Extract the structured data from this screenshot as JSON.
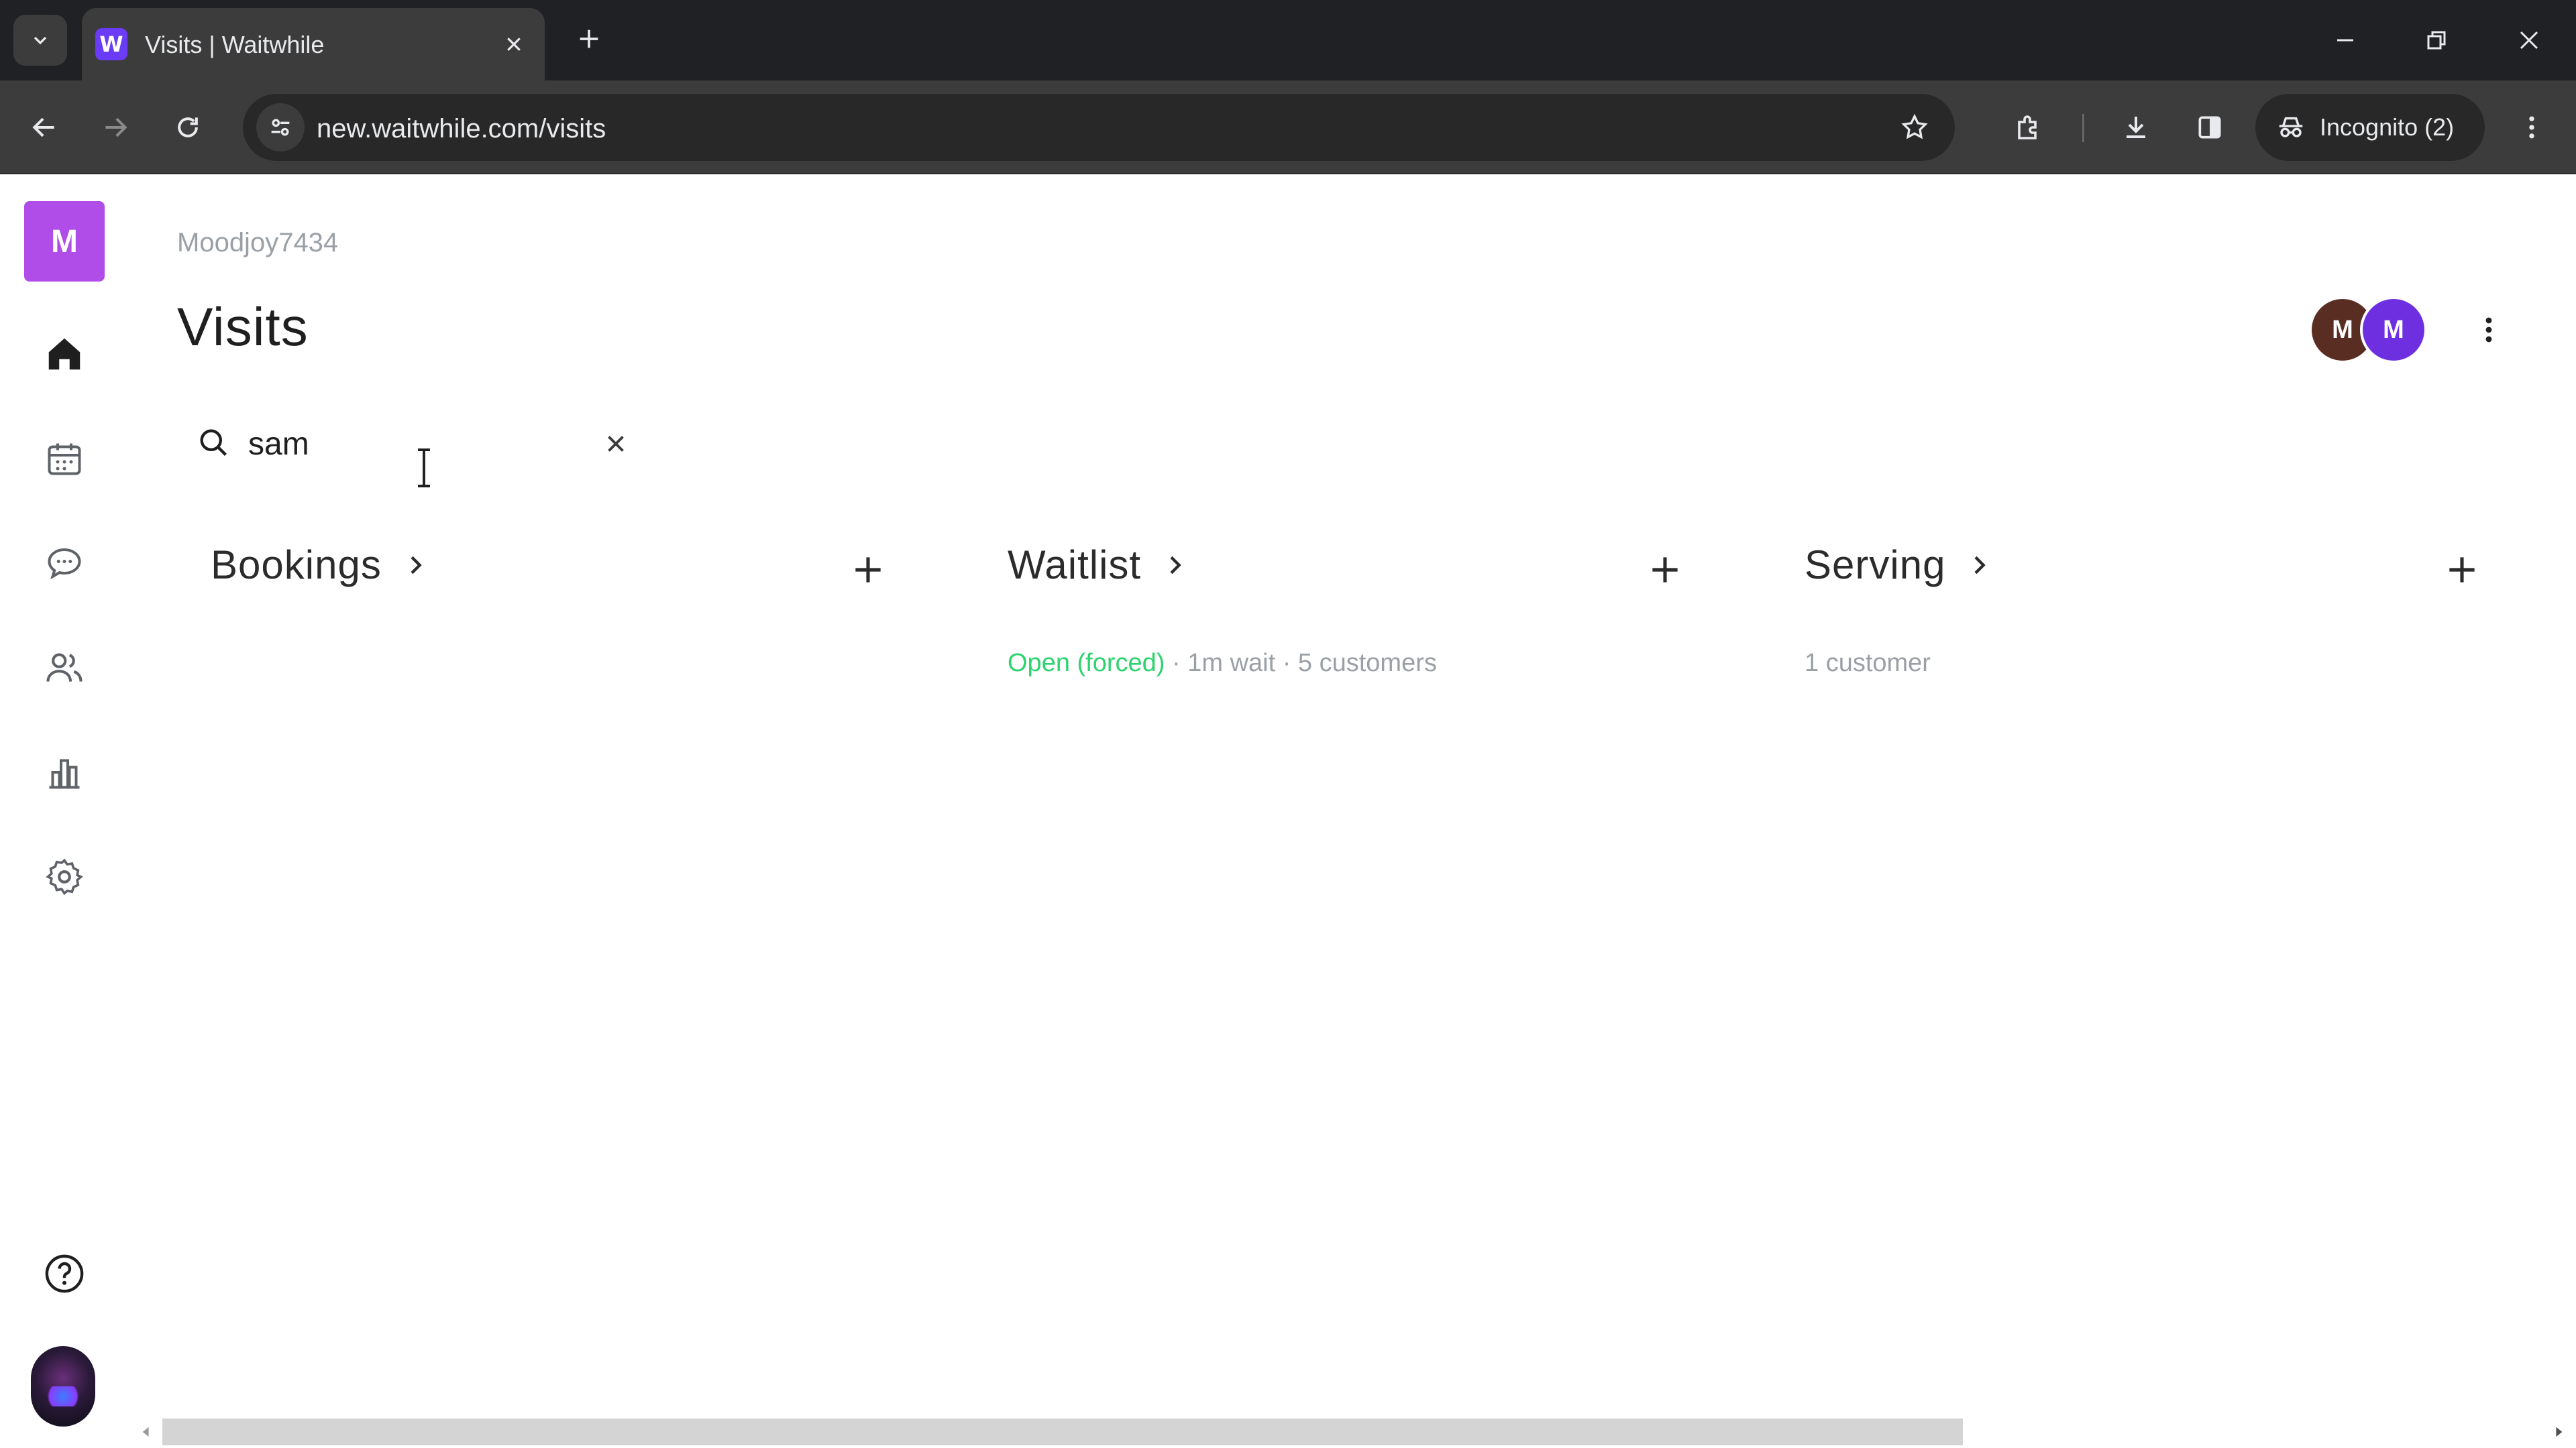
{
  "browser": {
    "tab_title": "Visits | Waitwhile",
    "favicon_letter": "W",
    "url": "new.waitwhile.com/visits",
    "incognito_label": "Incognito (2)"
  },
  "app": {
    "org_initial": "M",
    "breadcrumb": "Moodjoy7434",
    "page_title": "Visits",
    "avatars": [
      "M",
      "M"
    ],
    "nav": [
      {
        "name": "home",
        "icon": "home-icon",
        "active": true
      },
      {
        "name": "calendar",
        "icon": "calendar-icon",
        "active": false
      },
      {
        "name": "messages",
        "icon": "chat-icon",
        "active": false
      },
      {
        "name": "customers",
        "icon": "people-icon",
        "active": false
      },
      {
        "name": "analytics",
        "icon": "bar-chart-icon",
        "active": false
      },
      {
        "name": "settings",
        "icon": "gear-icon",
        "active": false
      }
    ],
    "search": {
      "value": "sam",
      "icon": "search-icon"
    },
    "columns": [
      {
        "title": "Bookings",
        "meta": ""
      },
      {
        "title": "Waitlist",
        "status": "Open (forced)",
        "meta": " · 1m wait · 5 customers"
      },
      {
        "title": "Serving",
        "meta": "1 customer"
      }
    ],
    "colors": {
      "brand": "#b04ce8",
      "status_open": "#2dd36f",
      "muted": "#9aa0a6"
    }
  }
}
